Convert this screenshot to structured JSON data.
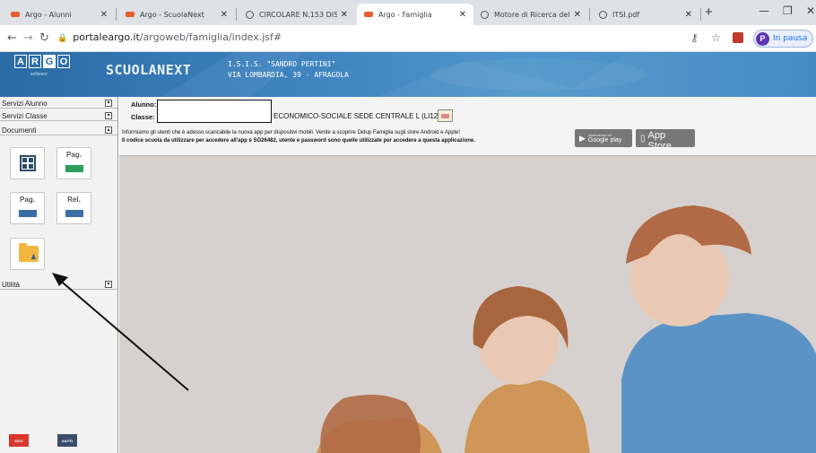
{
  "browser": {
    "tabs": [
      {
        "title": "Argo - Alunni",
        "favicon": "argo-favicon"
      },
      {
        "title": "Argo - ScuolaNext",
        "favicon": "argo-favicon"
      },
      {
        "title": "CIRCOLARE N.153 DISPO",
        "favicon": "globe-icon"
      },
      {
        "title": "Argo - Famiglia",
        "favicon": "argo-favicon",
        "active": true
      },
      {
        "title": "Motore di Ricerca delle M",
        "favicon": "globe-icon"
      },
      {
        "title": "ITSI.pdf",
        "favicon": "globe-icon"
      }
    ],
    "url_host": "portaleargo.it",
    "url_path": "/argoweb/famiglia/index.jsf#",
    "profile_initial": "P",
    "profile_status": "In pausa"
  },
  "header": {
    "logo_letters": [
      "A",
      "R",
      "G",
      "O"
    ],
    "logo_sub": "software",
    "product": "SCUOLANEXT",
    "school_line1": "I.S.I.S. \"SANDRO PERTINI\"",
    "school_line2": "VIA LOMBARDIA, 39 - AFRAGOLA"
  },
  "sidebar": {
    "sections": [
      "Servizi Alunno",
      "Servizi Classe",
      "Documenti",
      "Utilità"
    ],
    "doc_icons": [
      {
        "label": "",
        "icon": "grid-icon"
      },
      {
        "label": "Pag.",
        "icon": "pagella-icon"
      },
      {
        "label": "Pag.",
        "icon": "pagella-icon"
      },
      {
        "label": "Rel.",
        "icon": "relazione-icon"
      },
      {
        "label": "",
        "icon": "folder-user-icon"
      }
    ],
    "bottom_buttons": [
      "ESCI",
      "AIUTO"
    ]
  },
  "main": {
    "alunno_label": "Alunno:",
    "classe_label": "Classe:",
    "classe_value": "ECONOMICO-SOCIALE SEDE CENTRALE L (LI12)",
    "msg1": "Informiamo gli utenti che è adesso scaricabile la nuova app per dispositivi mobili. Venite a scoprire Didup Famiglia sugli store Android e Apple!",
    "msg2": "Il codice scuola da utilizzare per accedere all'app è SG26482, utente e password sono quelle utilizzate per accedere a questa applicazione.",
    "google_play_top": "ANDROID APP ON",
    "google_play": "Google play",
    "app_store_top": "Available on the",
    "app_store": "App Store"
  },
  "colors": {
    "header_blue": "#3d82bd",
    "argo_orange": "#e85d2a",
    "folder_yellow": "#f2b53e",
    "doc_green": "#2e9e5b",
    "doc_blue": "#3a6ea5"
  }
}
